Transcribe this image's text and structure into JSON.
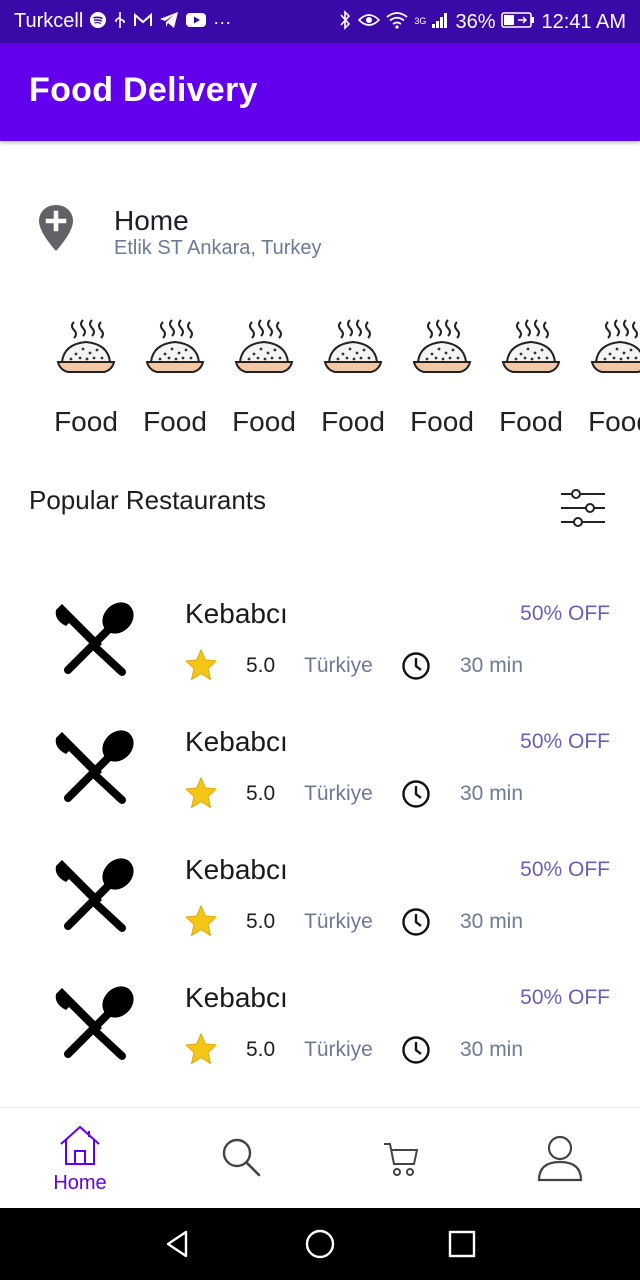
{
  "status_bar": {
    "carrier": "Turkcell",
    "left_icons": [
      "spotify-icon",
      "usb-icon",
      "mail-icon",
      "telegram-icon",
      "youtube-icon",
      "more-dots-icon"
    ],
    "right_icons": [
      "bluetooth-icon",
      "eye-icon",
      "wifi-icon",
      "signal-icon"
    ],
    "network": "3G",
    "battery": "36%",
    "time": "12:41 AM"
  },
  "app_bar": {
    "title": "Food Delivery"
  },
  "location": {
    "title": "Home",
    "address": "Etlik ST Ankara, Turkey",
    "icon": "location-pin-add-icon"
  },
  "categories": [
    {
      "label": "Food",
      "icon": "rice-bowl-icon"
    },
    {
      "label": "Food",
      "icon": "rice-bowl-icon"
    },
    {
      "label": "Food",
      "icon": "rice-bowl-icon"
    },
    {
      "label": "Food",
      "icon": "rice-bowl-icon"
    },
    {
      "label": "Food",
      "icon": "rice-bowl-icon"
    },
    {
      "label": "Food",
      "icon": "rice-bowl-icon"
    },
    {
      "label": "Food",
      "icon": "rice-bowl-icon"
    }
  ],
  "popular": {
    "title": "Popular Restaurants",
    "filter_icon": "filter-sliders-icon"
  },
  "restaurants": [
    {
      "name": "Kebabcı",
      "discount": "50% OFF",
      "rating": "5.0",
      "country": "Türkiye",
      "time": "30 min"
    },
    {
      "name": "Kebabcı",
      "discount": "50% OFF",
      "rating": "5.0",
      "country": "Türkiye",
      "time": "30 min"
    },
    {
      "name": "Kebabcı",
      "discount": "50% OFF",
      "rating": "5.0",
      "country": "Türkiye",
      "time": "30 min"
    },
    {
      "name": "Kebabcı",
      "discount": "50% OFF",
      "rating": "5.0",
      "country": "Türkiye",
      "time": "30 min"
    }
  ],
  "bottom_nav": {
    "items": [
      {
        "label": "Home",
        "icon": "home-icon",
        "active": true
      },
      {
        "label": "",
        "icon": "search-icon",
        "active": false
      },
      {
        "label": "",
        "icon": "cart-icon",
        "active": false
      },
      {
        "label": "",
        "icon": "profile-icon",
        "active": false
      }
    ]
  },
  "system_nav": {
    "icons": [
      "back-icon",
      "home-circle-icon",
      "recents-icon"
    ]
  },
  "colors": {
    "status_bar": "#3a0aa8",
    "app_bar": "#6200ee",
    "accent": "#6200ee",
    "discount": "#6a5fb8",
    "secondary_text": "#6b7a96",
    "star": "#f5c518"
  }
}
